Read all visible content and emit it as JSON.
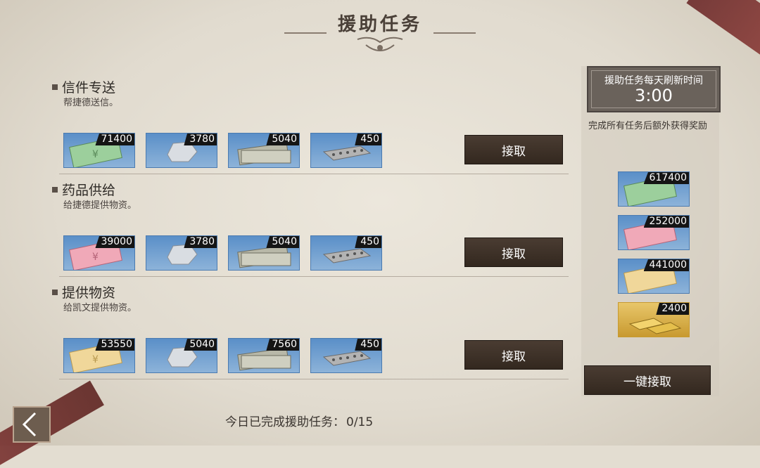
{
  "title": "援助任务",
  "tasks": [
    {
      "name": "信件专送",
      "desc": "帮捷德送信。",
      "accept": "接取",
      "items": [
        {
          "icon": "green-banknote-icon",
          "qty": "71400",
          "bg": "#7fb083"
        },
        {
          "icon": "silver-ore-icon",
          "qty": "3780",
          "bg": "#8fb0d3"
        },
        {
          "icon": "cash-stack-icon",
          "qty": "5040",
          "bg": "#8fb0d3"
        },
        {
          "icon": "concrete-block-icon",
          "qty": "450",
          "bg": "#8fb0d3"
        }
      ]
    },
    {
      "name": "药品供给",
      "desc": "给捷德提供物资。",
      "accept": "接取",
      "items": [
        {
          "icon": "pink-banknote-icon",
          "qty": "39000",
          "bg": "#d98ea0"
        },
        {
          "icon": "silver-ore-icon",
          "qty": "3780",
          "bg": "#8fb0d3"
        },
        {
          "icon": "cash-stack-icon",
          "qty": "5040",
          "bg": "#8fb0d3"
        },
        {
          "icon": "concrete-block-icon",
          "qty": "450",
          "bg": "#8fb0d3"
        }
      ]
    },
    {
      "name": "提供物资",
      "desc": "给凯文提供物资。",
      "accept": "接取",
      "items": [
        {
          "icon": "yellow-banknote-icon",
          "qty": "53550",
          "bg": "#d9c27f"
        },
        {
          "icon": "silver-ore-icon",
          "qty": "5040",
          "bg": "#8fb0d3"
        },
        {
          "icon": "cash-stack-icon",
          "qty": "7560",
          "bg": "#8fb0d3"
        },
        {
          "icon": "concrete-block-icon",
          "qty": "450",
          "bg": "#8fb0d3"
        }
      ]
    }
  ],
  "side": {
    "refresh_label": "援助任务每天刷新时间",
    "refresh_time": "3:00",
    "extra_label": "完成所有任务后额外获得奖励",
    "rewards": [
      {
        "icon": "green-banknote-icon",
        "qty": "617400"
      },
      {
        "icon": "pink-banknote-icon",
        "qty": "252000"
      },
      {
        "icon": "yellow-banknote-icon",
        "qty": "441000"
      },
      {
        "icon": "gold-bars-icon",
        "qty": "2400"
      }
    ],
    "all_accept": "一键接取"
  },
  "progress": {
    "label": "今日已完成援助任务：",
    "value": "0/15"
  },
  "colors": {
    "button": "#3f3329",
    "item_border": "#4a7ab0",
    "gold_border": "#c89a30"
  }
}
